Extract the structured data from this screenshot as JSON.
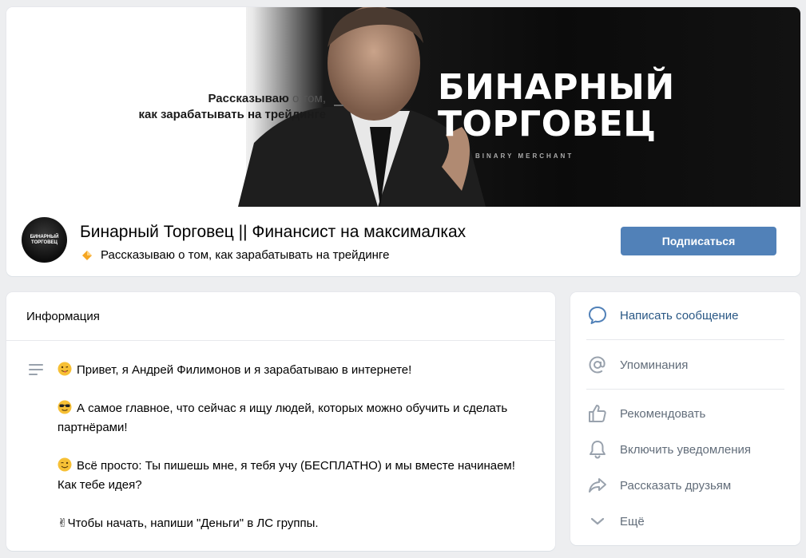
{
  "cover": {
    "tagline_bold_1": "Рассказываю",
    "tagline_light_1": " о том,",
    "tagline_bold_2": "как зарабатывать на трейдинге",
    "title_line_1": "БИНАРНЫЙ",
    "title_line_2": "ТОРГОВЕЦ",
    "subtitle": "BINARY MERCHANT"
  },
  "group": {
    "avatar_text": "БИНАРНЫЙ ТОРГОВЕЦ",
    "title": "Бинарный Торговец || Финансист на максималках",
    "status": "Рассказываю о том, как зарабатывать на трейдинге",
    "subscribe_label": "Подписаться"
  },
  "info": {
    "title": "Информация",
    "paragraphs": {
      "p1": "Привет, я Андрей Филимонов и я зарабатываю в интернете!",
      "p2": "А самое главное, что сейчас я ищу людей, которых можно обучить и сделать партнёрами!",
      "p3": "Всё просто: Ты пишешь мне, я тебя учу (БЕСПЛАТНО) и мы вместе начинаем! Как тебе идея?",
      "p4": "✌Чтобы начать, напиши \"Деньги\" в ЛС группы."
    }
  },
  "actions": {
    "message": "Написать сообщение",
    "mentions": "Упоминания",
    "recommend": "Рекомендовать",
    "notifications": "Включить уведомления",
    "share": "Рассказать друзьям",
    "more": "Ещё"
  },
  "colors": {
    "accent": "#5181b8",
    "link": "#2a5885",
    "icon": "#99a2ad",
    "background": "#edeef0"
  },
  "icons": {
    "status": "diamond-icon",
    "info": "lines-icon",
    "message": "chat-bubble-icon",
    "mentions": "at-icon",
    "recommend": "thumbs-up-icon",
    "notifications": "bell-icon",
    "share": "share-arrow-icon",
    "more": "chevron-down-icon"
  }
}
